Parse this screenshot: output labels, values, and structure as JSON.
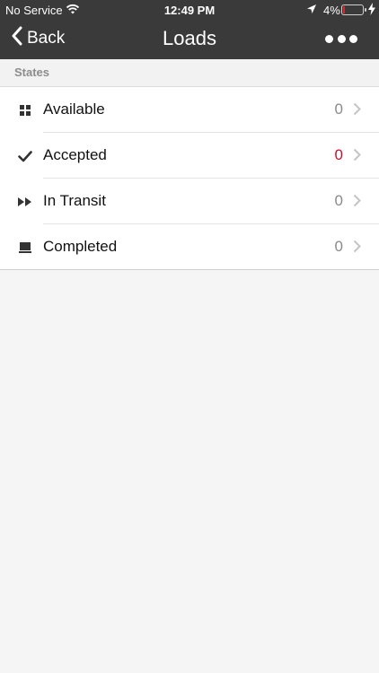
{
  "status_bar": {
    "carrier": "No Service",
    "time": "12:49 PM",
    "battery_percent": "4%"
  },
  "nav": {
    "back_label": "Back",
    "title": "Loads"
  },
  "section": {
    "header": "States"
  },
  "states": [
    {
      "label": "Available",
      "count": "0",
      "icon": "grid-icon"
    },
    {
      "label": "Accepted",
      "count": "0",
      "icon": "checkmark-icon",
      "count_color": "#c8102e"
    },
    {
      "label": "In Transit",
      "count": "0",
      "icon": "fast-forward-icon"
    },
    {
      "label": "Completed",
      "count": "0",
      "icon": "laptop-icon"
    }
  ],
  "colors": {
    "nav_bar": "#3a3a3a",
    "background": "#f5f5f5",
    "alert": "#c8102e"
  }
}
